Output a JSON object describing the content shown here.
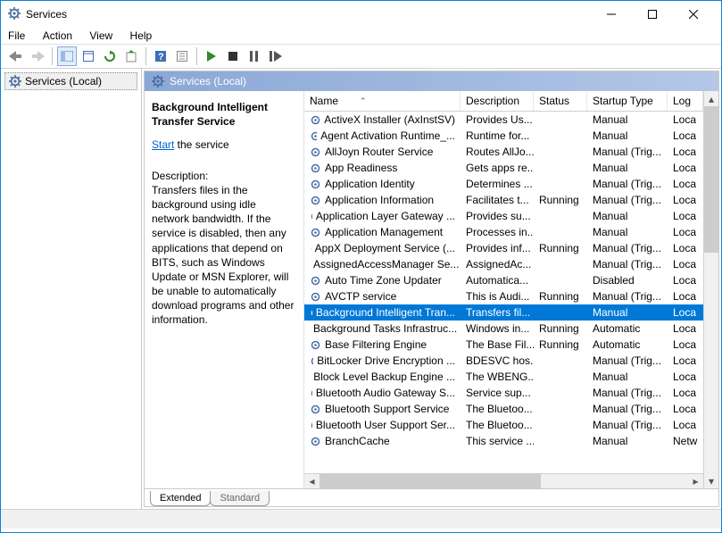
{
  "window": {
    "title": "Services",
    "menus": [
      "File",
      "Action",
      "View",
      "Help"
    ]
  },
  "left_pane": {
    "label": "Services (Local)"
  },
  "right_header": "Services (Local)",
  "detail": {
    "title": "Background Intelligent Transfer Service",
    "start_link": "Start",
    "start_suffix": " the service",
    "desc_label": "Description:",
    "desc_text": "Transfers files in the background using idle network bandwidth. If the service is disabled, then any applications that depend on BITS, such as Windows Update or MSN Explorer, will be unable to automatically download programs and other information."
  },
  "columns": {
    "name": "Name",
    "description": "Description",
    "status": "Status",
    "startup": "Startup Type",
    "logon": "Log"
  },
  "tabs": {
    "extended": "Extended",
    "standard": "Standard"
  },
  "rows": [
    {
      "name": "ActiveX Installer (AxInstSV)",
      "desc": "Provides Us...",
      "status": "",
      "startup": "Manual",
      "logon": "Loca"
    },
    {
      "name": "Agent Activation Runtime_...",
      "desc": "Runtime for...",
      "status": "",
      "startup": "Manual",
      "logon": "Loca"
    },
    {
      "name": "AllJoyn Router Service",
      "desc": "Routes AllJo...",
      "status": "",
      "startup": "Manual (Trig...",
      "logon": "Loca"
    },
    {
      "name": "App Readiness",
      "desc": "Gets apps re...",
      "status": "",
      "startup": "Manual",
      "logon": "Loca"
    },
    {
      "name": "Application Identity",
      "desc": "Determines ...",
      "status": "",
      "startup": "Manual (Trig...",
      "logon": "Loca"
    },
    {
      "name": "Application Information",
      "desc": "Facilitates t...",
      "status": "Running",
      "startup": "Manual (Trig...",
      "logon": "Loca"
    },
    {
      "name": "Application Layer Gateway ...",
      "desc": "Provides su...",
      "status": "",
      "startup": "Manual",
      "logon": "Loca"
    },
    {
      "name": "Application Management",
      "desc": "Processes in...",
      "status": "",
      "startup": "Manual",
      "logon": "Loca"
    },
    {
      "name": "AppX Deployment Service (...",
      "desc": "Provides inf...",
      "status": "Running",
      "startup": "Manual (Trig...",
      "logon": "Loca"
    },
    {
      "name": "AssignedAccessManager Se...",
      "desc": "AssignedAc...",
      "status": "",
      "startup": "Manual (Trig...",
      "logon": "Loca"
    },
    {
      "name": "Auto Time Zone Updater",
      "desc": "Automatica...",
      "status": "",
      "startup": "Disabled",
      "logon": "Loca"
    },
    {
      "name": "AVCTP service",
      "desc": "This is Audi...",
      "status": "Running",
      "startup": "Manual (Trig...",
      "logon": "Loca"
    },
    {
      "name": "Background Intelligent Tran...",
      "desc": "Transfers fil...",
      "status": "",
      "startup": "Manual",
      "logon": "Loca",
      "selected": true
    },
    {
      "name": "Background Tasks Infrastruc...",
      "desc": "Windows in...",
      "status": "Running",
      "startup": "Automatic",
      "logon": "Loca"
    },
    {
      "name": "Base Filtering Engine",
      "desc": "The Base Fil...",
      "status": "Running",
      "startup": "Automatic",
      "logon": "Loca"
    },
    {
      "name": "BitLocker Drive Encryption ...",
      "desc": "BDESVC hos...",
      "status": "",
      "startup": "Manual (Trig...",
      "logon": "Loca"
    },
    {
      "name": "Block Level Backup Engine ...",
      "desc": "The WBENG...",
      "status": "",
      "startup": "Manual",
      "logon": "Loca"
    },
    {
      "name": "Bluetooth Audio Gateway S...",
      "desc": "Service sup...",
      "status": "",
      "startup": "Manual (Trig...",
      "logon": "Loca"
    },
    {
      "name": "Bluetooth Support Service",
      "desc": "The Bluetoo...",
      "status": "",
      "startup": "Manual (Trig...",
      "logon": "Loca"
    },
    {
      "name": "Bluetooth User Support Ser...",
      "desc": "The Bluetoo...",
      "status": "",
      "startup": "Manual (Trig...",
      "logon": "Loca"
    },
    {
      "name": "BranchCache",
      "desc": "This service ...",
      "status": "",
      "startup": "Manual",
      "logon": "Netw"
    }
  ]
}
